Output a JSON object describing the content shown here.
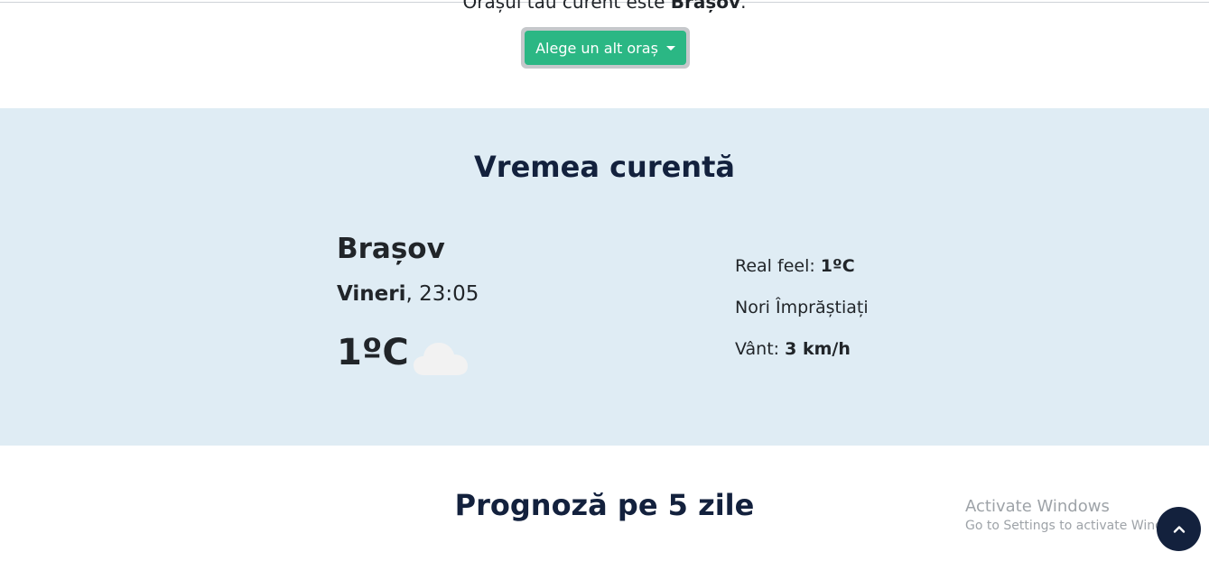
{
  "header": {
    "city_prefix": "Orașul tău curent este ",
    "city_value": "Brașov",
    "city_suffix": ".",
    "choose_city_button": "Alege un alt oraș"
  },
  "current": {
    "title": "Vremea curentă",
    "city": "Brașov",
    "day": "Vineri",
    "time": ", 23:05",
    "temperature": "1ºC",
    "condition_icon": "cloud-icon",
    "real_feel_label": "Real feel: ",
    "real_feel_value": "1ºC",
    "description": "Nori Împrăștiați",
    "wind_label": "Vânt: ",
    "wind_value": "3 km/h",
    "background": "#dfecf4"
  },
  "forecast": {
    "title": "Prognoză pe 5 zile"
  },
  "watermark": {
    "line1": "Activate Windows",
    "line2": "Go to Settings to activate Windows."
  },
  "scroll_top_icon": "chevron-up-icon",
  "colors": {
    "accent": "#2bb784",
    "navy": "#13213d"
  }
}
